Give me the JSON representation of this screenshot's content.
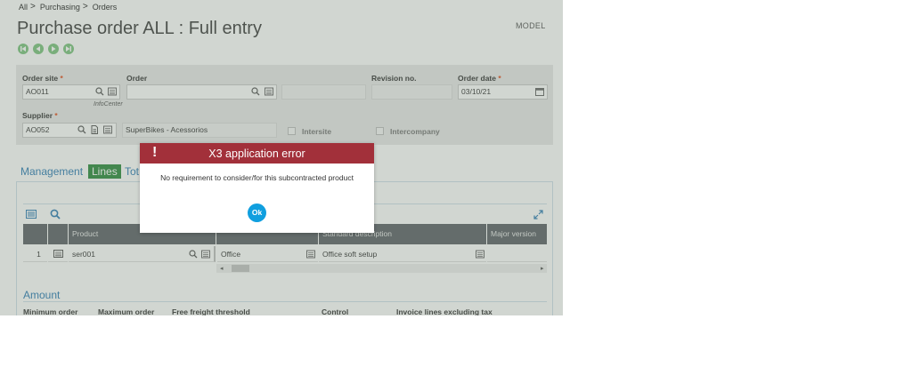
{
  "breadcrumb": [
    "All",
    "Purchasing",
    "Orders"
  ],
  "model_label": "MODEL",
  "page_title": "Purchase order ALL : Full entry",
  "nav_icons": [
    "first-record-icon",
    "previous-record-icon",
    "next-record-icon",
    "last-record-icon"
  ],
  "header": {
    "order_site": {
      "label": "Order site",
      "value": "AO011",
      "hint": "InfoCenter"
    },
    "order": {
      "label": "Order",
      "value": ""
    },
    "revision_no": {
      "label": "Revision no.",
      "value": ""
    },
    "order_date": {
      "label": "Order date",
      "value": "03/10/21"
    },
    "supplier": {
      "label": "Supplier",
      "value": "AO052",
      "name": "SuperBikes - Acessorios"
    },
    "intersite": {
      "label": "Intersite",
      "checked": false
    },
    "intercompany": {
      "label": "Intercompany",
      "checked": false
    }
  },
  "tabs": [
    "Management",
    "Lines",
    "Tot"
  ],
  "lines_table": {
    "columns": [
      "Product",
      "Standard description",
      "Major version"
    ],
    "rows": [
      {
        "num": "1",
        "product": "ser001",
        "col3": "Office",
        "description": "Office soft setup"
      }
    ]
  },
  "amount_section": {
    "title": "Amount",
    "fields": [
      "Minimum order",
      "Maximum order",
      "Free freight threshold",
      "Control",
      "Invoice lines excluding tax"
    ]
  },
  "dialog": {
    "title": "X3 application error",
    "message": "No requirement to consider/for this subcontracted product",
    "ok_label": "Ok"
  },
  "colors": {
    "dialog_header": "#a2303a",
    "ok_button": "#109fdf",
    "active_tab": "#2c8a3c",
    "nav_button": "#7cc47f",
    "link_blue": "#2e7db5"
  }
}
